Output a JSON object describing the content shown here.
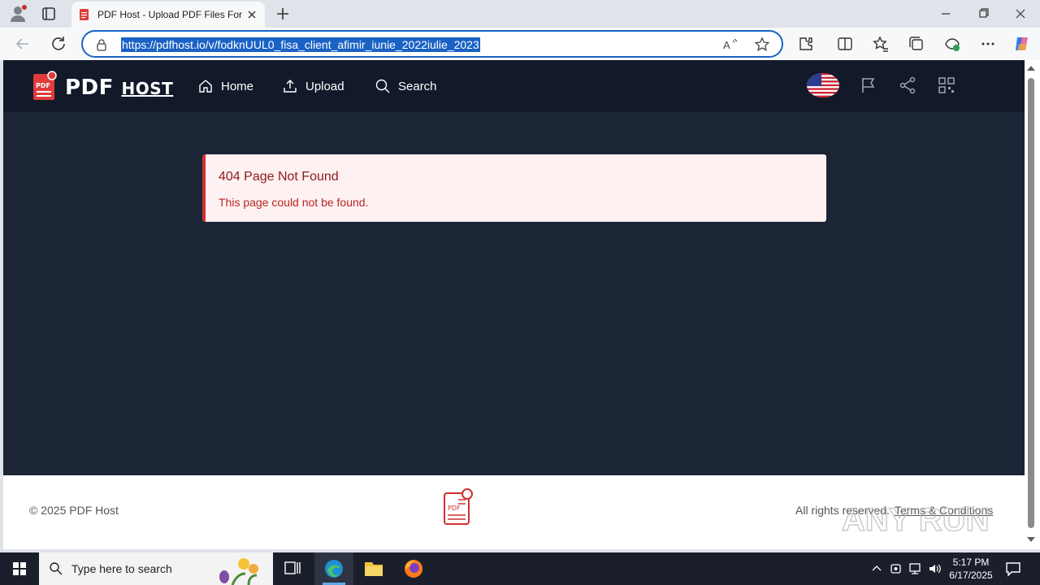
{
  "browser": {
    "tab_title": "PDF Host - Upload PDF Files For F",
    "url": "https://pdfhost.io/v/fodknUUL0_fisa_client_afimir_iunie_2022iulie_2023"
  },
  "site": {
    "logo_main": "PDF",
    "logo_small": "HOST",
    "nav": [
      {
        "label": "Home",
        "icon": "home-icon"
      },
      {
        "label": "Upload",
        "icon": "upload-icon"
      },
      {
        "label": "Search",
        "icon": "search-icon"
      }
    ],
    "header_icons": [
      "us-flag-icon",
      "flag-icon",
      "share-icon",
      "qr-code-icon"
    ]
  },
  "alert": {
    "title": "404 Page Not Found",
    "message": "This page could not be found."
  },
  "footer": {
    "copyright": "© 2025 PDF Host",
    "rights": "All rights reserved.",
    "terms": "Terms & Conditions"
  },
  "watermark": "ANY RUN",
  "taskbar": {
    "search_placeholder": "Type here to search",
    "time": "5:17 PM",
    "date": "6/17/2025"
  },
  "colors": {
    "accent": "#1a62c4",
    "page_bg": "#1c2536",
    "nav_bg": "#121a2a",
    "alert_bg": "#fef1f1",
    "alert_border": "#d12f2f",
    "brand_red": "#e03b3b"
  }
}
